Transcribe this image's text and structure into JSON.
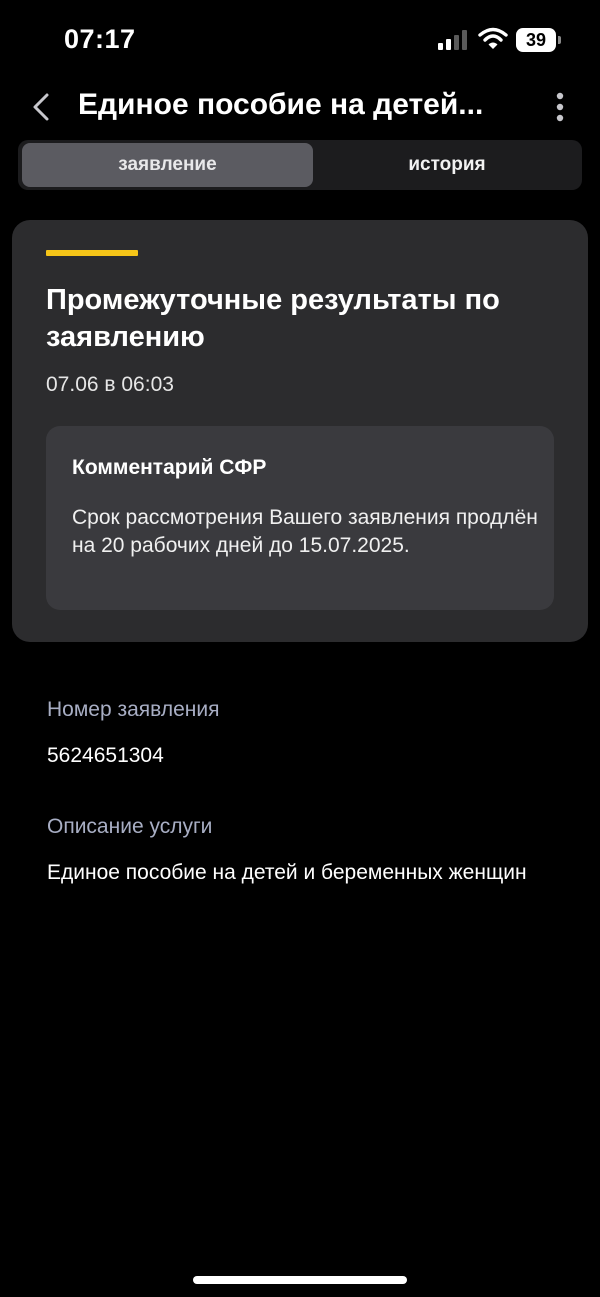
{
  "status_bar": {
    "time": "07:17",
    "battery": "39",
    "icons": [
      "signal-icon",
      "wifi-icon",
      "battery-icon"
    ]
  },
  "header": {
    "title": "Единое пособие на детей...",
    "back_icon": "chevron-left-icon",
    "more_icon": "more-vertical-icon"
  },
  "tabs": [
    {
      "label": "заявление",
      "active": true
    },
    {
      "label": "история",
      "active": false
    }
  ],
  "status_card": {
    "accent_color": "#f5c518",
    "title": "Промежуточные результаты по заявлению",
    "date": "07.06 в 06:03",
    "comment": {
      "title": "Комментарий СФР",
      "text": "Срок рассмотрения Вашего заявления продлён на 20 рабочих дней до 15.07.2025."
    }
  },
  "details": {
    "application_number_label": "Номер заявления",
    "application_number": "5624651304",
    "service_description_label": "Описание услуги",
    "service_description": "Единое пособие на детей и беременных женщин"
  },
  "colors": {
    "background": "#000000",
    "card": "#2c2c2e",
    "comment_box": "#3a3a3e",
    "label": "#a8aec4",
    "accent": "#f5c518"
  }
}
